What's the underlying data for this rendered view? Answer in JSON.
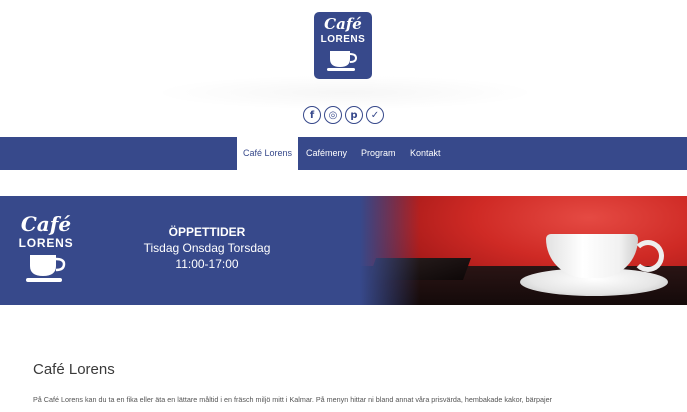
{
  "header": {
    "logo": {
      "cafe": "Café",
      "lorens": "LORENS"
    },
    "social": [
      {
        "icon": "facebook-icon",
        "glyph": "f"
      },
      {
        "icon": "instagram-icon",
        "glyph": "◎"
      },
      {
        "icon": "pinterest-icon",
        "glyph": "p"
      },
      {
        "icon": "twitter-icon",
        "glyph": "✓"
      }
    ]
  },
  "nav": {
    "items": [
      {
        "label": "Café Lorens",
        "active": true
      },
      {
        "label": "Cafémeny",
        "active": false
      },
      {
        "label": "Program",
        "active": false
      },
      {
        "label": "Kontakt",
        "active": false
      }
    ]
  },
  "banner": {
    "logo": {
      "cafe": "Café",
      "lorens": "LORENS"
    },
    "hours_title": "ÖPPETTIDER",
    "days": "Tisdag Onsdag Torsdag",
    "time": "11:00-17:00"
  },
  "content": {
    "title": "Café Lorens",
    "paragraph": "På Café Lorens kan du ta en fika eller äta en lättare måltid i en fräsch miljö mitt i Kalmar. På menyn hittar ni bland annat våra prisvärda, hembakade kakor, bärpajer"
  },
  "colors": {
    "brand": "#37498b",
    "background": "#ffffff"
  }
}
